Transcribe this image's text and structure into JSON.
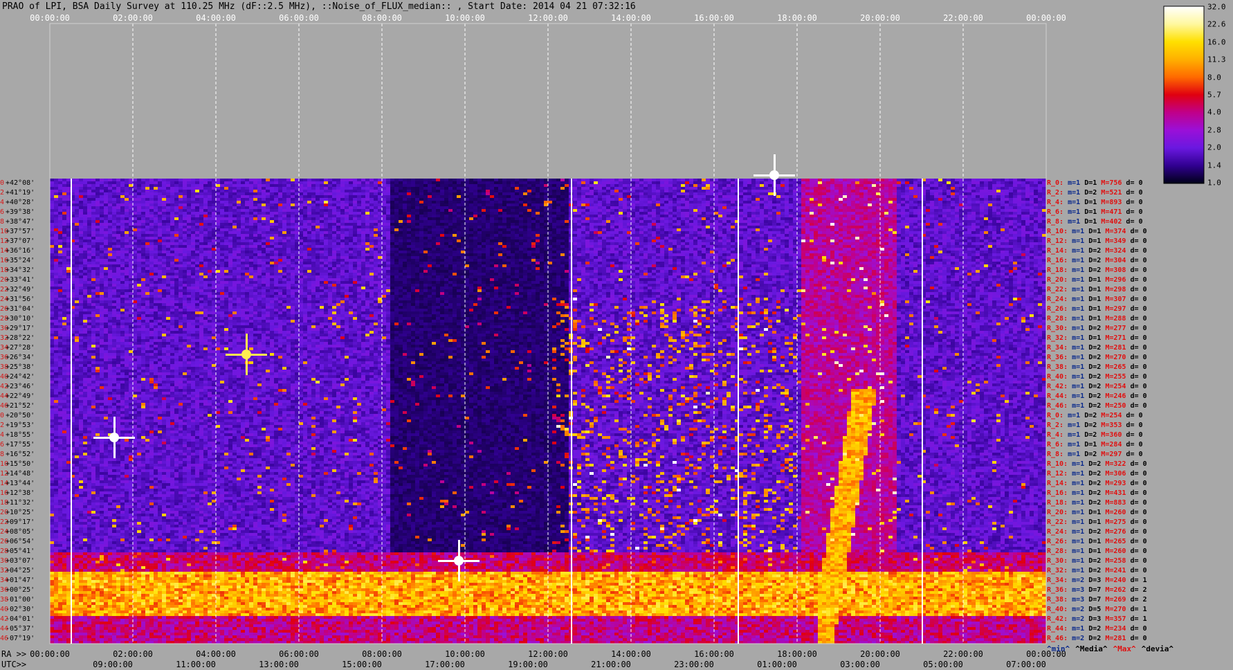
{
  "title": "PRAO of LPI, BSA Daily Survey at 110.25 MHz (dF::2.5 MHz), ::Noise_of_FLUX_median:: , Start Date: 2014 04 21 07:32:16",
  "top_axis_ticks": [
    "00:00:00",
    "02:00:00",
    "04:00:00",
    "06:00:00",
    "08:00:00",
    "10:00:00",
    "12:00:00",
    "14:00:00",
    "16:00:00",
    "18:00:00",
    "20:00:00",
    "22:00:00",
    "00:00:00"
  ],
  "ra_prefix": "RA >>",
  "ra_ticks": [
    "00:00:00",
    "02:00:00",
    "04:00:00",
    "06:00:00",
    "08:00:00",
    "10:00:00",
    "12:00:00",
    "14:00:00",
    "16:00:00",
    "18:00:00",
    "20:00:00",
    "22:00:00",
    "00:00:00"
  ],
  "utc_prefix": "UTC>>",
  "utc_ticks": [
    "09:00:00",
    "11:00:00",
    "13:00:00",
    "15:00:00",
    "17:00:00",
    "19:00:00",
    "21:00:00",
    "23:00:00",
    "01:00:00",
    "03:00:00",
    "05:00:00",
    "07:00:00"
  ],
  "colorbar": {
    "ticks": [
      "32.0",
      "22.6",
      "16.0",
      "11.3",
      "8.0",
      "5.7",
      "4.0",
      "2.8",
      "2.0",
      "1.4",
      "1.0"
    ],
    "colors": [
      "#ffffff",
      "#fff8a0",
      "#ffe000",
      "#ffb000",
      "#ff6a00",
      "#e00010",
      "#c0008a",
      "#9a10d8",
      "#6a18e0",
      "#300090",
      "#000018"
    ]
  },
  "declinations": [
    "+42°08'",
    "+41°19'",
    "+40°28'",
    "+39°38'",
    "+38°47'",
    "+37°57'",
    "+37°07'",
    "+36°16'",
    "+35°24'",
    "+34°32'",
    "+33°41'",
    "+32°49'",
    "+31°56'",
    "+31°04'",
    "+30°10'",
    "+29°17'",
    "+28°22'",
    "+27°28'",
    "+26°34'",
    "+25°38'",
    "+24°42'",
    "+23°46'",
    "+22°49'",
    "+21°52'",
    "+20°50'",
    "+19°53'",
    "+18°55'",
    "+17°55'",
    "+16°52'",
    "+15°50'",
    "+14°48'",
    "+13°44'",
    "+12°38'",
    "+11°32'",
    "+10°25'",
    "+09°17'",
    "+08°05'",
    "+06°54'",
    "+05°41'",
    "+03°07'",
    "+04°25'",
    "+01°47'",
    "+00°25'",
    "-01°00'",
    "-02°30'",
    "-04°01'",
    "-05°37'",
    "-07°19'"
  ],
  "dec_indices": [
    "0",
    "2",
    "4",
    "6",
    "8",
    "10",
    "12",
    "14",
    "16",
    "18",
    "20",
    "22",
    "24",
    "26",
    "28",
    "30",
    "32",
    "34",
    "36",
    "38",
    "40",
    "42",
    "44",
    "46",
    "0",
    "2",
    "4",
    "6",
    "8",
    "10",
    "12",
    "14",
    "16",
    "18",
    "20",
    "22",
    "24",
    "26",
    "28",
    "30",
    "32",
    "34",
    "36",
    "38",
    "40",
    "42",
    "44",
    "46"
  ],
  "stats": [
    {
      "r": "R_0:",
      "m": "m=1",
      "d": "D=1",
      "M": "M=756",
      "dv": "d= 0"
    },
    {
      "r": "R_2:",
      "m": "m=1",
      "d": "D=2",
      "M": "M=521",
      "dv": "d= 0"
    },
    {
      "r": "R_4:",
      "m": "m=1",
      "d": "D=1",
      "M": "M=893",
      "dv": "d= 0"
    },
    {
      "r": "R_6:",
      "m": "m=1",
      "d": "D=1",
      "M": "M=471",
      "dv": "d= 0"
    },
    {
      "r": "R_8:",
      "m": "m=1",
      "d": "D=1",
      "M": "M=402",
      "dv": "d= 0"
    },
    {
      "r": "R_10:",
      "m": "m=1",
      "d": "D=1",
      "M": "M=374",
      "dv": "d= 0"
    },
    {
      "r": "R_12:",
      "m": "m=1",
      "d": "D=1",
      "M": "M=349",
      "dv": "d= 0"
    },
    {
      "r": "R_14:",
      "m": "m=1",
      "d": "D=2",
      "M": "M=324",
      "dv": "d= 0"
    },
    {
      "r": "R_16:",
      "m": "m=1",
      "d": "D=2",
      "M": "M=304",
      "dv": "d= 0"
    },
    {
      "r": "R_18:",
      "m": "m=1",
      "d": "D=2",
      "M": "M=308",
      "dv": "d= 0"
    },
    {
      "r": "R_20:",
      "m": "m=1",
      "d": "D=1",
      "M": "M=296",
      "dv": "d= 0"
    },
    {
      "r": "R_22:",
      "m": "m=1",
      "d": "D=1",
      "M": "M=298",
      "dv": "d= 0"
    },
    {
      "r": "R_24:",
      "m": "m=1",
      "d": "D=1",
      "M": "M=307",
      "dv": "d= 0"
    },
    {
      "r": "R_26:",
      "m": "m=1",
      "d": "D=1",
      "M": "M=297",
      "dv": "d= 0"
    },
    {
      "r": "R_28:",
      "m": "m=1",
      "d": "D=1",
      "M": "M=288",
      "dv": "d= 0"
    },
    {
      "r": "R_30:",
      "m": "m=1",
      "d": "D=2",
      "M": "M=277",
      "dv": "d= 0"
    },
    {
      "r": "R_32:",
      "m": "m=1",
      "d": "D=1",
      "M": "M=271",
      "dv": "d= 0"
    },
    {
      "r": "R_34:",
      "m": "m=1",
      "d": "D=2",
      "M": "M=281",
      "dv": "d= 0"
    },
    {
      "r": "R_36:",
      "m": "m=1",
      "d": "D=2",
      "M": "M=270",
      "dv": "d= 0"
    },
    {
      "r": "R_38:",
      "m": "m=1",
      "d": "D=2",
      "M": "M=265",
      "dv": "d= 0"
    },
    {
      "r": "R_40:",
      "m": "m=1",
      "d": "D=2",
      "M": "M=255",
      "dv": "d= 0"
    },
    {
      "r": "R_42:",
      "m": "m=1",
      "d": "D=2",
      "M": "M=254",
      "dv": "d= 0"
    },
    {
      "r": "R_44:",
      "m": "m=1",
      "d": "D=2",
      "M": "M=246",
      "dv": "d= 0"
    },
    {
      "r": "R_46:",
      "m": "m=1",
      "d": "D=2",
      "M": "M=250",
      "dv": "d= 0"
    },
    {
      "r": "R_0:",
      "m": "m=1",
      "d": "D=2",
      "M": "M=254",
      "dv": "d= 0"
    },
    {
      "r": "R_2:",
      "m": "m=1",
      "d": "D=2",
      "M": "M=353",
      "dv": "d= 0"
    },
    {
      "r": "R_4:",
      "m": "m=1",
      "d": "D=2",
      "M": "M=360",
      "dv": "d= 0"
    },
    {
      "r": "R_6:",
      "m": "m=1",
      "d": "D=1",
      "M": "M=284",
      "dv": "d= 0"
    },
    {
      "r": "R_8:",
      "m": "m=1",
      "d": "D=2",
      "M": "M=297",
      "dv": "d= 0"
    },
    {
      "r": "R_10:",
      "m": "m=1",
      "d": "D=2",
      "M": "M=322",
      "dv": "d= 0"
    },
    {
      "r": "R_12:",
      "m": "m=1",
      "d": "D=2",
      "M": "M=306",
      "dv": "d= 0"
    },
    {
      "r": "R_14:",
      "m": "m=1",
      "d": "D=2",
      "M": "M=293",
      "dv": "d= 0"
    },
    {
      "r": "R_16:",
      "m": "m=1",
      "d": "D=2",
      "M": "M=431",
      "dv": "d= 0"
    },
    {
      "r": "R_18:",
      "m": "m=1",
      "d": "D=2",
      "M": "M=883",
      "dv": "d= 0"
    },
    {
      "r": "R_20:",
      "m": "m=1",
      "d": "D=1",
      "M": "M=260",
      "dv": "d= 0"
    },
    {
      "r": "R_22:",
      "m": "m=1",
      "d": "D=1",
      "M": "M=275",
      "dv": "d= 0"
    },
    {
      "r": "R_24:",
      "m": "m=1",
      "d": "D=2",
      "M": "M=276",
      "dv": "d= 0"
    },
    {
      "r": "R_26:",
      "m": "m=1",
      "d": "D=1",
      "M": "M=265",
      "dv": "d= 0"
    },
    {
      "r": "R_28:",
      "m": "m=1",
      "d": "D=1",
      "M": "M=260",
      "dv": "d= 0"
    },
    {
      "r": "R_30:",
      "m": "m=1",
      "d": "D=2",
      "M": "M=258",
      "dv": "d= 0"
    },
    {
      "r": "R_32:",
      "m": "m=1",
      "d": "D=2",
      "M": "M=241",
      "dv": "d= 0"
    },
    {
      "r": "R_34:",
      "m": "m=2",
      "d": "D=3",
      "M": "M=240",
      "dv": "d= 1"
    },
    {
      "r": "R_36:",
      "m": "m=3",
      "d": "D=7",
      "M": "M=262",
      "dv": "d= 2"
    },
    {
      "r": "R_38:",
      "m": "m=3",
      "d": "D=7",
      "M": "M=269",
      "dv": "d= 2"
    },
    {
      "r": "R_40:",
      "m": "m=2",
      "d": "D=5",
      "M": "M=270",
      "dv": "d= 1"
    },
    {
      "r": "R_42:",
      "m": "m=2",
      "d": "D=3",
      "M": "M=357",
      "dv": "d= 1"
    },
    {
      "r": "R_44:",
      "m": "m=1",
      "d": "D=2",
      "M": "M=234",
      "dv": "d= 0"
    },
    {
      "r": "R_46:",
      "m": "m=2",
      "d": "D=2",
      "M": "M=281",
      "dv": "d= 0"
    }
  ],
  "stat_footer": [
    "^min^",
    "^Media^",
    "^Max^",
    "^devia^"
  ],
  "chart_data": {
    "type": "heatmap",
    "title": "PRAO of LPI, BSA Daily Survey at 110.25 MHz (dF::2.5 MHz), ::Noise_of_FLUX_median:: , Start Date: 2014 04 21 07:32:16",
    "x_ra_ticks": [
      "00:00:00",
      "02:00:00",
      "04:00:00",
      "06:00:00",
      "08:00:00",
      "10:00:00",
      "12:00:00",
      "14:00:00",
      "16:00:00",
      "18:00:00",
      "20:00:00",
      "22:00:00",
      "00:00:00"
    ],
    "x_utc_ticks": [
      "09:00:00",
      "11:00:00",
      "13:00:00",
      "15:00:00",
      "17:00:00",
      "19:00:00",
      "21:00:00",
      "23:00:00",
      "01:00:00",
      "03:00:00",
      "05:00:00",
      "07:00:00"
    ],
    "colorscale": [
      1.0,
      32.0
    ],
    "colorscale_type": "log",
    "bright_features_ra_hours": [
      2.0,
      19.9,
      11.7
    ],
    "strong_band_declination": "+00°25' to -02°30'"
  }
}
